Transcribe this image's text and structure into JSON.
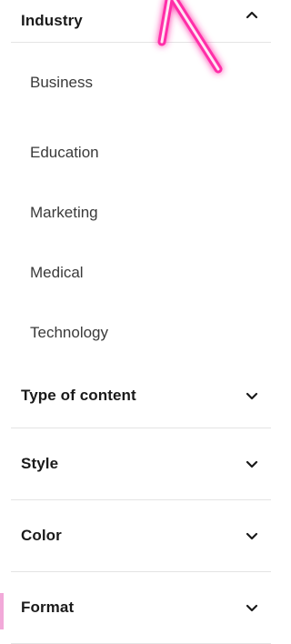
{
  "filters": {
    "industry": {
      "title": "Industry",
      "state_icon": "chevron-up-icon",
      "options": [
        "Business",
        "Education",
        "Marketing",
        "Medical",
        "Technology"
      ]
    },
    "type_of_content": {
      "title": "Type of content",
      "state_icon": "chevron-down-icon"
    },
    "style": {
      "title": "Style",
      "state_icon": "chevron-down-icon"
    },
    "color": {
      "title": "Color",
      "state_icon": "chevron-down-icon"
    },
    "format": {
      "title": "Format",
      "state_icon": "chevron-down-icon"
    }
  },
  "colors": {
    "accent_neon": "#ff2fa8",
    "divider": "#e4e4e4",
    "text": "#1a1a1a",
    "option_text": "#3a3a3a"
  }
}
